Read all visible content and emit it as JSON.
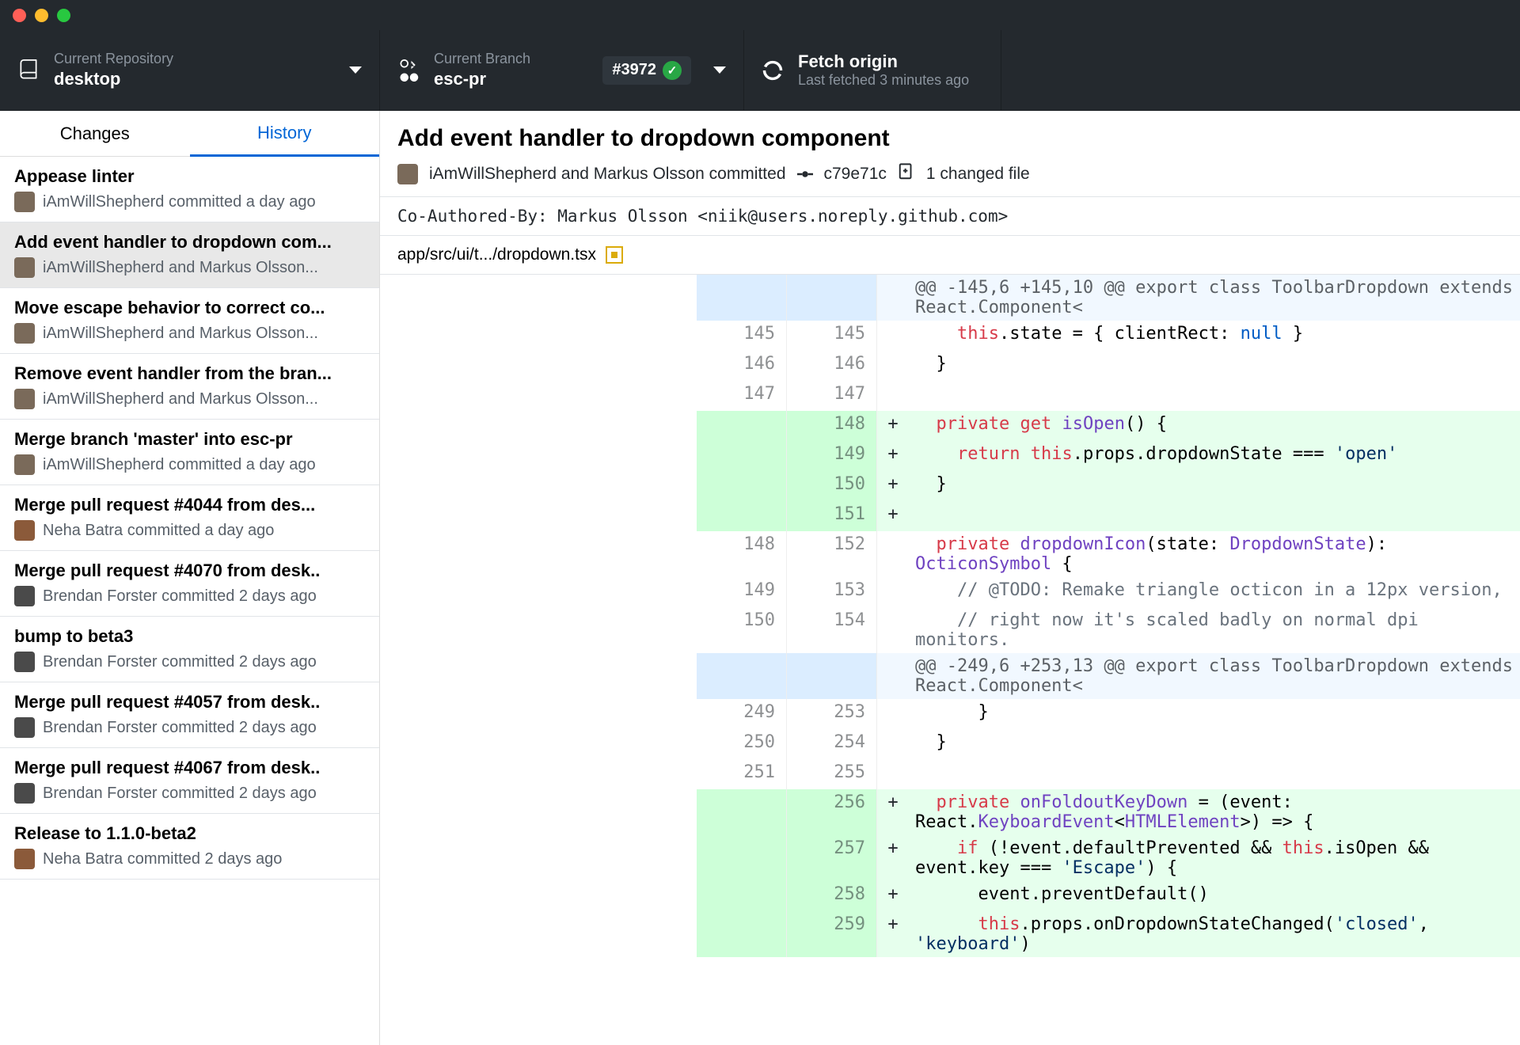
{
  "toolbar": {
    "repo": {
      "label": "Current Repository",
      "value": "desktop"
    },
    "branch": {
      "label": "Current Branch",
      "value": "esc-pr",
      "pr_badge": "#3972"
    },
    "fetch": {
      "label": "Fetch origin",
      "sub": "Last fetched 3 minutes ago"
    }
  },
  "tabs": {
    "changes": "Changes",
    "history": "History"
  },
  "commits": [
    {
      "title": "Appease linter",
      "meta": "iAmWillShepherd committed a day ago",
      "avatar": "#7a6a5a"
    },
    {
      "title": "Add event handler to dropdown com...",
      "meta": "iAmWillShepherd and Markus Olsson...",
      "avatar": "#7a6a5a",
      "selected": true
    },
    {
      "title": "Move escape behavior to correct co...",
      "meta": "iAmWillShepherd and Markus Olsson...",
      "avatar": "#7a6a5a"
    },
    {
      "title": "Remove event handler from the bran...",
      "meta": "iAmWillShepherd and Markus Olsson...",
      "avatar": "#7a6a5a"
    },
    {
      "title": "Merge branch 'master' into esc-pr",
      "meta": "iAmWillShepherd committed a day ago",
      "avatar": "#7a6a5a"
    },
    {
      "title": "Merge pull request #4044 from des...",
      "meta": "Neha Batra committed a day ago",
      "avatar": "#8b5a3a"
    },
    {
      "title": "Merge pull request #4070 from desk..",
      "meta": "Brendan Forster committed 2 days ago",
      "avatar": "#4a4a4a"
    },
    {
      "title": "bump to beta3",
      "meta": "Brendan Forster committed 2 days ago",
      "avatar": "#4a4a4a"
    },
    {
      "title": "Merge pull request #4057 from desk..",
      "meta": "Brendan Forster committed 2 days ago",
      "avatar": "#4a4a4a"
    },
    {
      "title": "Merge pull request #4067 from desk..",
      "meta": "Brendan Forster committed 2 days ago",
      "avatar": "#4a4a4a"
    },
    {
      "title": "Release to 1.1.0-beta2",
      "meta": "Neha Batra committed 2 days ago",
      "avatar": "#8b5a3a"
    }
  ],
  "detail": {
    "title": "Add event handler to dropdown component",
    "authors": "iAmWillShepherd and Markus Olsson committed",
    "sha": "c79e71c",
    "files_label": "1 changed file",
    "co_author": "Co-Authored-By: Markus Olsson <niik@users.noreply.github.com>",
    "file_path": "app/src/ui/t.../dropdown.tsx"
  },
  "diff": [
    {
      "type": "hunk",
      "old": "",
      "new": "",
      "code": "@@ -145,6 +145,10 @@ export class ToolbarDropdown extends React.Component<"
    },
    {
      "type": "ctx",
      "old": "145",
      "new": "145",
      "tokens": [
        [
          "",
          "    "
        ],
        [
          "kw",
          "this"
        ],
        [
          "",
          ".state = { clientRect: "
        ],
        [
          "const",
          "null"
        ],
        [
          "",
          " }"
        ]
      ]
    },
    {
      "type": "ctx",
      "old": "146",
      "new": "146",
      "tokens": [
        [
          "",
          "  }"
        ]
      ]
    },
    {
      "type": "ctx",
      "old": "147",
      "new": "147",
      "tokens": [
        [
          "",
          ""
        ]
      ]
    },
    {
      "type": "add",
      "old": "",
      "new": "148",
      "tokens": [
        [
          "",
          "  "
        ],
        [
          "kw",
          "private"
        ],
        [
          "",
          " "
        ],
        [
          "kw",
          "get"
        ],
        [
          "",
          " "
        ],
        [
          "fn",
          "isOpen"
        ],
        [
          "",
          "() {"
        ]
      ]
    },
    {
      "type": "add",
      "old": "",
      "new": "149",
      "tokens": [
        [
          "",
          "    "
        ],
        [
          "kw",
          "return"
        ],
        [
          "",
          " "
        ],
        [
          "kw",
          "this"
        ],
        [
          "",
          ".props.dropdownState === "
        ],
        [
          "str",
          "'open'"
        ]
      ]
    },
    {
      "type": "add",
      "old": "",
      "new": "150",
      "tokens": [
        [
          "",
          "  }"
        ]
      ]
    },
    {
      "type": "add",
      "old": "",
      "new": "151",
      "tokens": [
        [
          "",
          ""
        ]
      ]
    },
    {
      "type": "ctx",
      "old": "148",
      "new": "152",
      "tokens": [
        [
          "",
          "  "
        ],
        [
          "kw",
          "private"
        ],
        [
          "",
          " "
        ],
        [
          "fn",
          "dropdownIcon"
        ],
        [
          "",
          "(state: "
        ],
        [
          "type",
          "DropdownState"
        ],
        [
          "",
          "): "
        ],
        [
          "type",
          "OcticonSymbol"
        ],
        [
          "",
          " {"
        ]
      ]
    },
    {
      "type": "ctx",
      "old": "149",
      "new": "153",
      "tokens": [
        [
          "",
          "    "
        ],
        [
          "cmt",
          "// @TODO: Remake triangle octicon in a 12px version,"
        ]
      ]
    },
    {
      "type": "ctx",
      "old": "150",
      "new": "154",
      "tokens": [
        [
          "",
          "    "
        ],
        [
          "cmt",
          "// right now it's scaled badly on normal dpi monitors."
        ]
      ]
    },
    {
      "type": "hunk",
      "old": "",
      "new": "",
      "code": "@@ -249,6 +253,13 @@ export class ToolbarDropdown extends React.Component<"
    },
    {
      "type": "ctx",
      "old": "249",
      "new": "253",
      "tokens": [
        [
          "",
          "      }"
        ]
      ]
    },
    {
      "type": "ctx",
      "old": "250",
      "new": "254",
      "tokens": [
        [
          "",
          "  }"
        ]
      ]
    },
    {
      "type": "ctx",
      "old": "251",
      "new": "255",
      "tokens": [
        [
          "",
          ""
        ]
      ]
    },
    {
      "type": "add",
      "old": "",
      "new": "256",
      "tokens": [
        [
          "",
          "  "
        ],
        [
          "kw",
          "private"
        ],
        [
          "",
          " "
        ],
        [
          "fn",
          "onFoldoutKeyDown"
        ],
        [
          "",
          " = (event: React."
        ],
        [
          "type",
          "KeyboardEvent"
        ],
        [
          "",
          "<"
        ],
        [
          "type",
          "HTMLElement"
        ],
        [
          "",
          ">) => {"
        ]
      ]
    },
    {
      "type": "add",
      "old": "",
      "new": "257",
      "tokens": [
        [
          "",
          "    "
        ],
        [
          "kw",
          "if"
        ],
        [
          "",
          " (!event.defaultPrevented && "
        ],
        [
          "kw",
          "this"
        ],
        [
          "",
          ".isOpen && event.key === "
        ],
        [
          "str",
          "'Escape'"
        ],
        [
          "",
          ") {"
        ]
      ]
    },
    {
      "type": "add",
      "old": "",
      "new": "258",
      "tokens": [
        [
          "",
          "      event.preventDefault()"
        ]
      ]
    },
    {
      "type": "add",
      "old": "",
      "new": "259",
      "tokens": [
        [
          "",
          "      "
        ],
        [
          "kw",
          "this"
        ],
        [
          "",
          ".props.onDropdownStateChanged("
        ],
        [
          "str",
          "'closed'"
        ],
        [
          "",
          ", "
        ],
        [
          "str",
          "'keyboard'"
        ],
        [
          "",
          ")"
        ]
      ]
    }
  ]
}
